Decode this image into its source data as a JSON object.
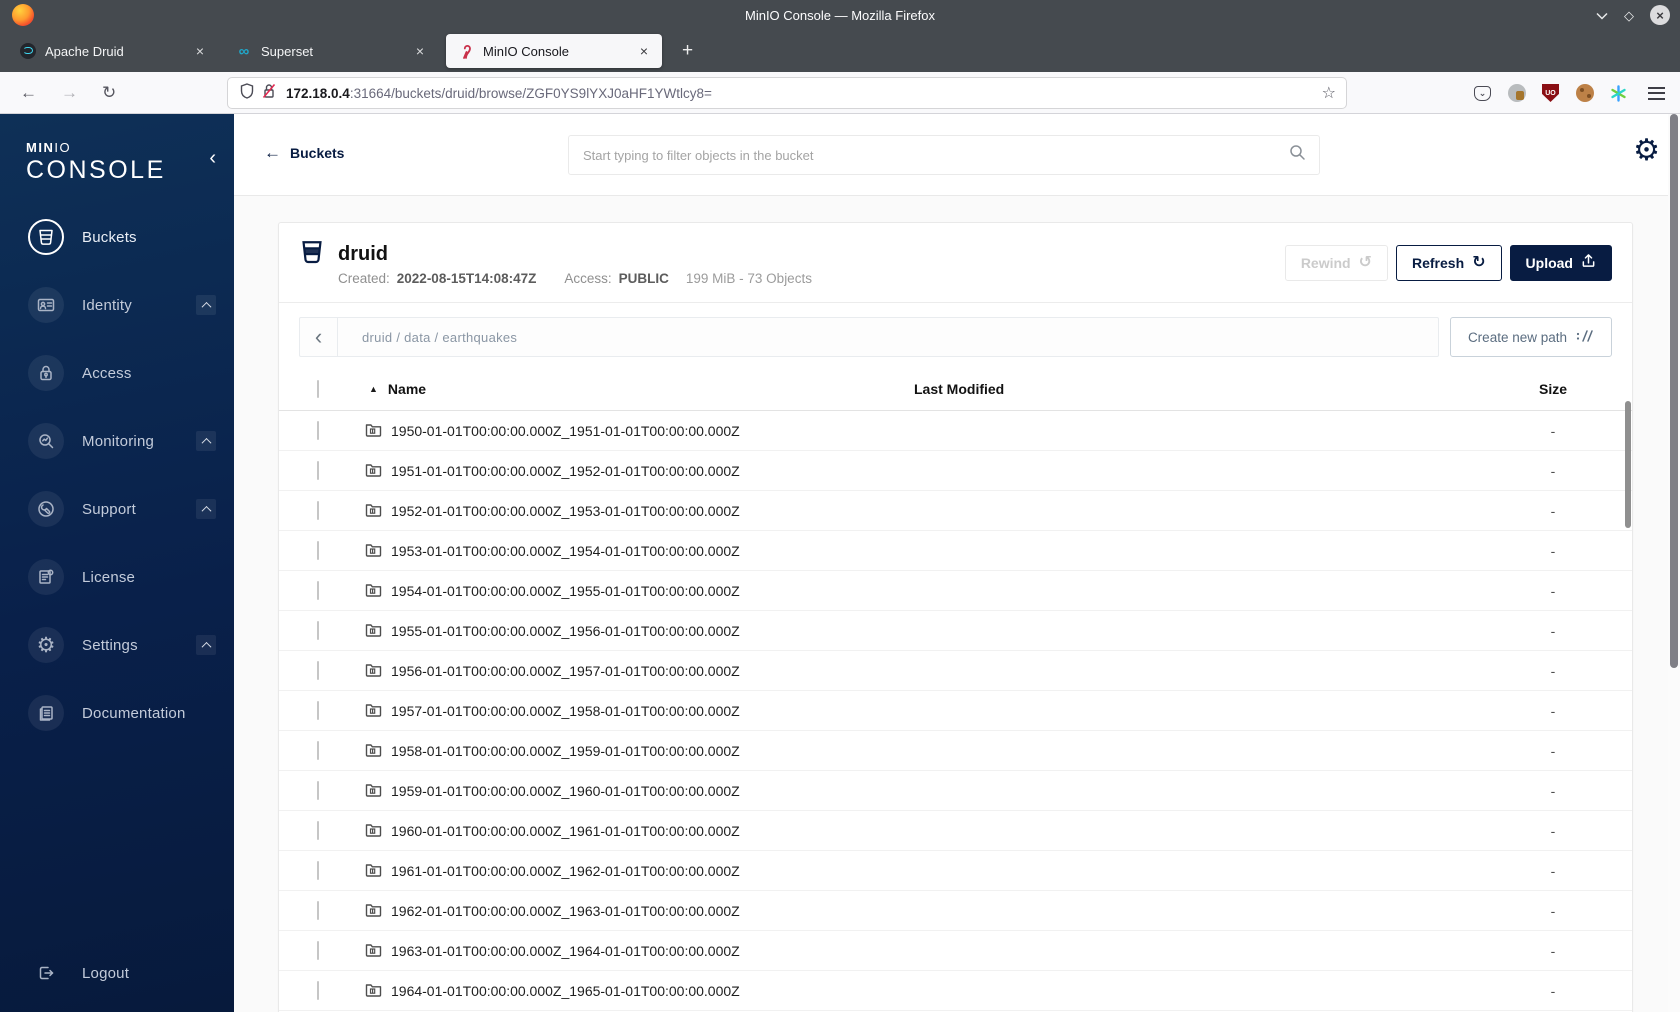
{
  "window": {
    "title": "MinIO Console — Mozilla Firefox"
  },
  "browser_chrome": {
    "tabs": [
      {
        "label": "Apache Druid"
      },
      {
        "label": "Superset"
      },
      {
        "label": "MinIO Console"
      }
    ],
    "close_glyph": "×",
    "new_tab_glyph": "+",
    "url": {
      "host": "172.18.0.4",
      "rest": ":31664/buckets/druid/browse/ZGF0YS9lYXJ0aHF1YWtlcy8="
    }
  },
  "sidebar": {
    "logo_top": "MIN",
    "logo_top_thin": "IO",
    "logo_bottom": "CONSOLE",
    "collapse_glyph": "‹",
    "items": [
      {
        "label": "Buckets",
        "active": true
      },
      {
        "label": "Identity",
        "expandable": true
      },
      {
        "label": "Access"
      },
      {
        "label": "Monitoring",
        "expandable": true
      },
      {
        "label": "Support",
        "expandable": true
      },
      {
        "label": "License"
      },
      {
        "label": "Settings",
        "expandable": true
      },
      {
        "label": "Documentation"
      }
    ],
    "logout_label": "Logout"
  },
  "header": {
    "back_label": "Buckets",
    "back_glyph": "←",
    "search_placeholder": "Start typing to filter objects in the bucket"
  },
  "bucket": {
    "name": "druid",
    "created_label": "Created:",
    "created_value": "2022-08-15T14:08:47Z",
    "access_label": "Access:",
    "access_value": "PUBLIC",
    "usage": "199 MiB - 73 Objects",
    "rewind_label": "Rewind",
    "refresh_label": "Refresh",
    "upload_label": "Upload",
    "rewind_glyph": "↺",
    "refresh_glyph": "↻"
  },
  "browse": {
    "back_glyph": "‹",
    "path": "druid / data / earthquakes",
    "create_path_label": "Create new path"
  },
  "table": {
    "columns": [
      "Name",
      "Last Modified",
      "Size"
    ],
    "sort_glyph": "▲",
    "rows": [
      {
        "name": "1950-01-01T00:00:00.000Z_1951-01-01T00:00:00.000Z",
        "last_modified": "",
        "size": "-"
      },
      {
        "name": "1951-01-01T00:00:00.000Z_1952-01-01T00:00:00.000Z",
        "last_modified": "",
        "size": "-"
      },
      {
        "name": "1952-01-01T00:00:00.000Z_1953-01-01T00:00:00.000Z",
        "last_modified": "",
        "size": "-"
      },
      {
        "name": "1953-01-01T00:00:00.000Z_1954-01-01T00:00:00.000Z",
        "last_modified": "",
        "size": "-"
      },
      {
        "name": "1954-01-01T00:00:00.000Z_1955-01-01T00:00:00.000Z",
        "last_modified": "",
        "size": "-"
      },
      {
        "name": "1955-01-01T00:00:00.000Z_1956-01-01T00:00:00.000Z",
        "last_modified": "",
        "size": "-"
      },
      {
        "name": "1956-01-01T00:00:00.000Z_1957-01-01T00:00:00.000Z",
        "last_modified": "",
        "size": "-"
      },
      {
        "name": "1957-01-01T00:00:00.000Z_1958-01-01T00:00:00.000Z",
        "last_modified": "",
        "size": "-"
      },
      {
        "name": "1958-01-01T00:00:00.000Z_1959-01-01T00:00:00.000Z",
        "last_modified": "",
        "size": "-"
      },
      {
        "name": "1959-01-01T00:00:00.000Z_1960-01-01T00:00:00.000Z",
        "last_modified": "",
        "size": "-"
      },
      {
        "name": "1960-01-01T00:00:00.000Z_1961-01-01T00:00:00.000Z",
        "last_modified": "",
        "size": "-"
      },
      {
        "name": "1961-01-01T00:00:00.000Z_1962-01-01T00:00:00.000Z",
        "last_modified": "",
        "size": "-"
      },
      {
        "name": "1962-01-01T00:00:00.000Z_1963-01-01T00:00:00.000Z",
        "last_modified": "",
        "size": "-"
      },
      {
        "name": "1963-01-01T00:00:00.000Z_1964-01-01T00:00:00.000Z",
        "last_modified": "",
        "size": "-"
      },
      {
        "name": "1964-01-01T00:00:00.000Z_1965-01-01T00:00:00.000Z",
        "last_modified": "",
        "size": "-"
      }
    ]
  },
  "colors": {
    "accent_navy": "#081C42",
    "sidebar_gradient_top": "#0E3057",
    "sidebar_gradient_bottom": "#071A3C",
    "chrome_dark": "#454A4F",
    "superset_teal": "#20A7C9",
    "ublock_red": "#8A0F14",
    "minio_red": "#C9304A"
  }
}
